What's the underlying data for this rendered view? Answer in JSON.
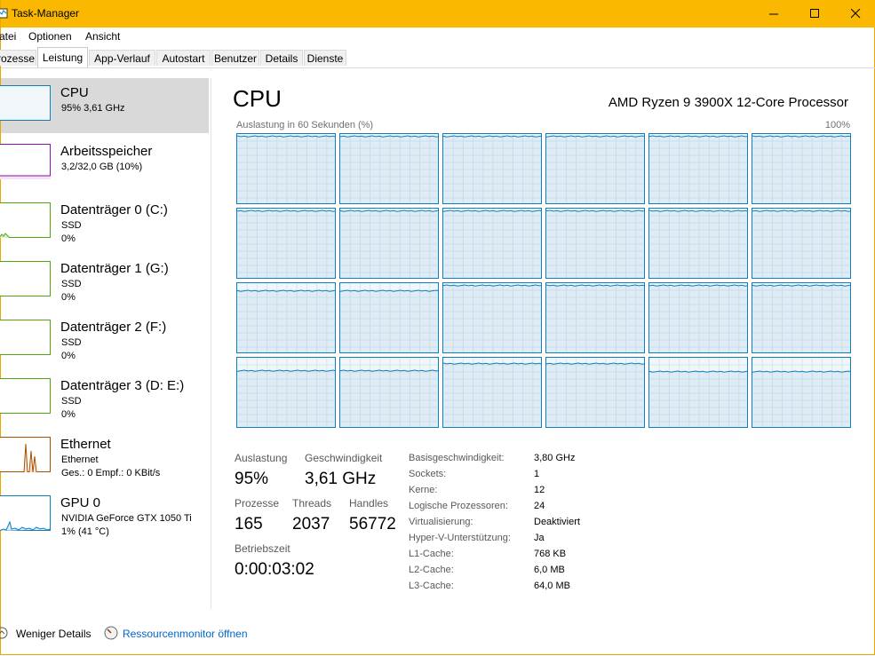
{
  "window": {
    "title": "Task-Manager"
  },
  "menu": [
    "atei",
    "Optionen",
    "Ansicht"
  ],
  "tabs": [
    "rozesse",
    "Leistung",
    "App-Verlauf",
    "Autostart",
    "Benutzer",
    "Details",
    "Dienste"
  ],
  "active_tab": "Leistung",
  "sidebar": [
    {
      "name": "CPU",
      "sub1": "95% 3,61 GHz",
      "sub2": "",
      "color": "#117dbb"
    },
    {
      "name": "Arbeitsspeicher",
      "sub1": "3,2/32,0 GB (10%)",
      "sub2": "",
      "color": "#8b12ae"
    },
    {
      "name": "Datenträger 0 (C:)",
      "sub1": "SSD",
      "sub2": "0%",
      "color": "#4da60c"
    },
    {
      "name": "Datenträger 1 (G:)",
      "sub1": "SSD",
      "sub2": "0%",
      "color": "#4da60c"
    },
    {
      "name": "Datenträger 2 (F:)",
      "sub1": "SSD",
      "sub2": "0%",
      "color": "#4da60c"
    },
    {
      "name": "Datenträger 3 (D: E:)",
      "sub1": "SSD",
      "sub2": "0%",
      "color": "#4da60c"
    },
    {
      "name": "Ethernet",
      "sub1": "Ethernet",
      "sub2": "Ges.: 0 Empf.: 0 KBit/s",
      "color": "#a74f01"
    },
    {
      "name": "GPU 0",
      "sub1": "NVIDIA GeForce GTX 1050 Ti",
      "sub2": "1% (41 °C)",
      "color": "#117dbb"
    }
  ],
  "main": {
    "title": "CPU",
    "processor": "AMD Ryzen 9 3900X 12-Core Processor",
    "graph_label": "Auslastung in 60 Sekunden (%)",
    "graph_max": "100%",
    "core_count": 24,
    "stats": {
      "auslastung_label": "Auslastung",
      "auslastung": "95%",
      "geschw_label": "Geschwindigkeit",
      "geschw": "3,61 GHz",
      "prozesse_label": "Prozesse",
      "prozesse": "165",
      "threads_label": "Threads",
      "threads": "2037",
      "handles_label": "Handles",
      "handles": "56772",
      "betrieb_label": "Betriebszeit",
      "betrieb": "0:00:03:02"
    },
    "specs": [
      {
        "label": "Basisgeschwindigkeit:",
        "value": "3,80 GHz"
      },
      {
        "label": "Sockets:",
        "value": "1"
      },
      {
        "label": "Kerne:",
        "value": "12"
      },
      {
        "label": "Logische Prozessoren:",
        "value": "24"
      },
      {
        "label": "Virtualisierung:",
        "value": "Deaktiviert"
      },
      {
        "label": "Hyper-V-Unterstützung:",
        "value": "Ja"
      },
      {
        "label": "L1-Cache:",
        "value": "768 KB"
      },
      {
        "label": "L2-Cache:",
        "value": "6,0 MB"
      },
      {
        "label": "L3-Cache:",
        "value": "64,0 MB"
      }
    ]
  },
  "footer": {
    "less": "Weniger Details",
    "resmon": "Ressourcenmonitor öffnen"
  }
}
